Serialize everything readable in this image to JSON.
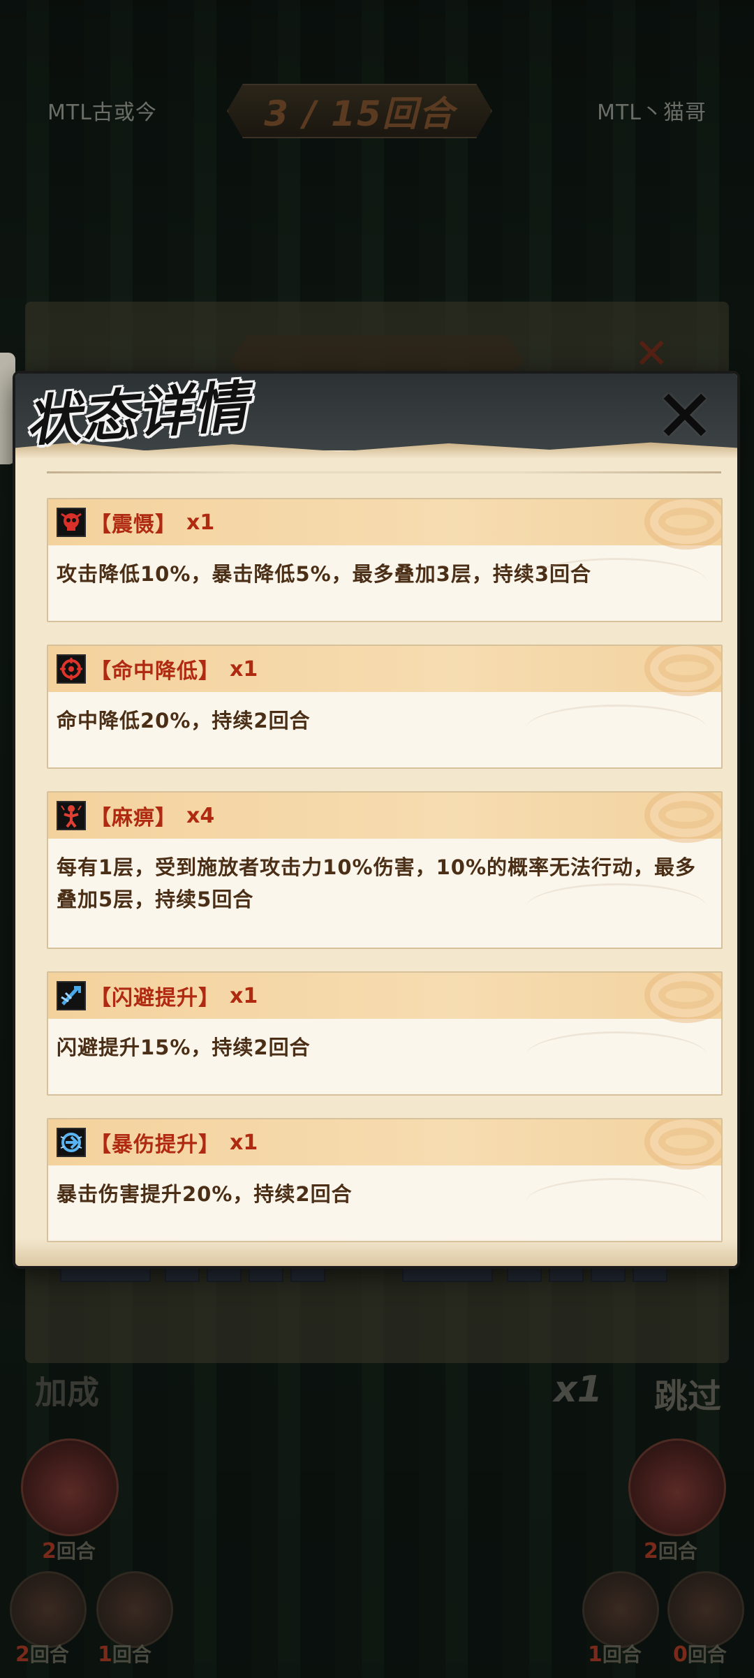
{
  "top_bar": {
    "left_player": "MTL古或今",
    "right_player": "MTL丶猫哥",
    "round_text": "3 / 15回合"
  },
  "modal": {
    "title": "状态详情",
    "close_icon": "close-x-icon",
    "statuses": [
      {
        "icon": "skull-fear-icon",
        "icon_color": "#d9302a",
        "name": "【震慑】",
        "stack": "x1",
        "description": "攻击降低10%，暴击降低5%，最多叠加3层，持续3回合"
      },
      {
        "icon": "crosshair-icon",
        "icon_color": "#e0342a",
        "name": "【命中降低】",
        "stack": "x1",
        "description": "命中降低20%，持续2回合"
      },
      {
        "icon": "paralysis-icon",
        "icon_color": "#e04034",
        "name": "【麻痹】",
        "stack": "x4",
        "description": "每有1层，受到施放者攻击力10%伤害，10%的概率无法行动，最多叠加5层，持续5回合"
      },
      {
        "icon": "dodge-up-icon",
        "icon_color": "#4aa8e8",
        "name": "【闪避提升】",
        "stack": "x1",
        "description": "闪避提升15%，持续2回合"
      },
      {
        "icon": "crit-damage-up-icon",
        "icon_color": "#5ab4f0",
        "name": "【暴伤提升】",
        "stack": "x1",
        "description": "暴击伤害提升20%，持续2回合"
      }
    ]
  },
  "hud": {
    "add_label": "加成",
    "speed_label": "x1",
    "skip_label": "跳过",
    "turns": [
      {
        "num": "2",
        "suffix": "回合"
      },
      {
        "num": "2",
        "suffix": "回合"
      },
      {
        "num": "2",
        "suffix": "回合"
      },
      {
        "num": "1",
        "suffix": "回合"
      },
      {
        "num": "1",
        "suffix": "回合"
      },
      {
        "num": "0",
        "suffix": "回合"
      }
    ]
  }
}
